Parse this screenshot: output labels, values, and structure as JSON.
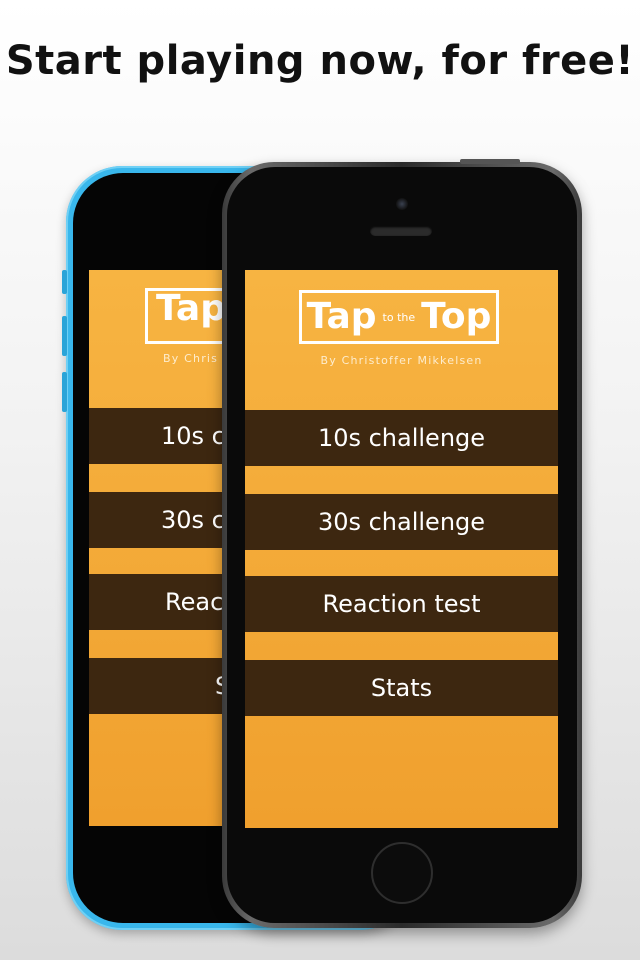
{
  "headline": "Start playing now, for free!",
  "app": {
    "logo": {
      "big_left": "Tap",
      "small_middle": "to the",
      "big_right": "Top"
    },
    "byline": "By Christoffer Mikkelsen",
    "menu": [
      {
        "label": "10s challenge"
      },
      {
        "label": "30s challenge"
      },
      {
        "label": "Reaction test"
      },
      {
        "label": "Stats"
      }
    ]
  },
  "back_phone": {
    "logo_visible": "Tap",
    "byline_visible": "By Chris",
    "menu_visible": [
      "10s c",
      "30s c",
      "Reac",
      "S"
    ]
  },
  "colors": {
    "screen_orange": "#f5aa38",
    "button_brown": "#3d2710",
    "phone_blue": "#39b7ec",
    "phone_black": "#0a0a0a"
  }
}
